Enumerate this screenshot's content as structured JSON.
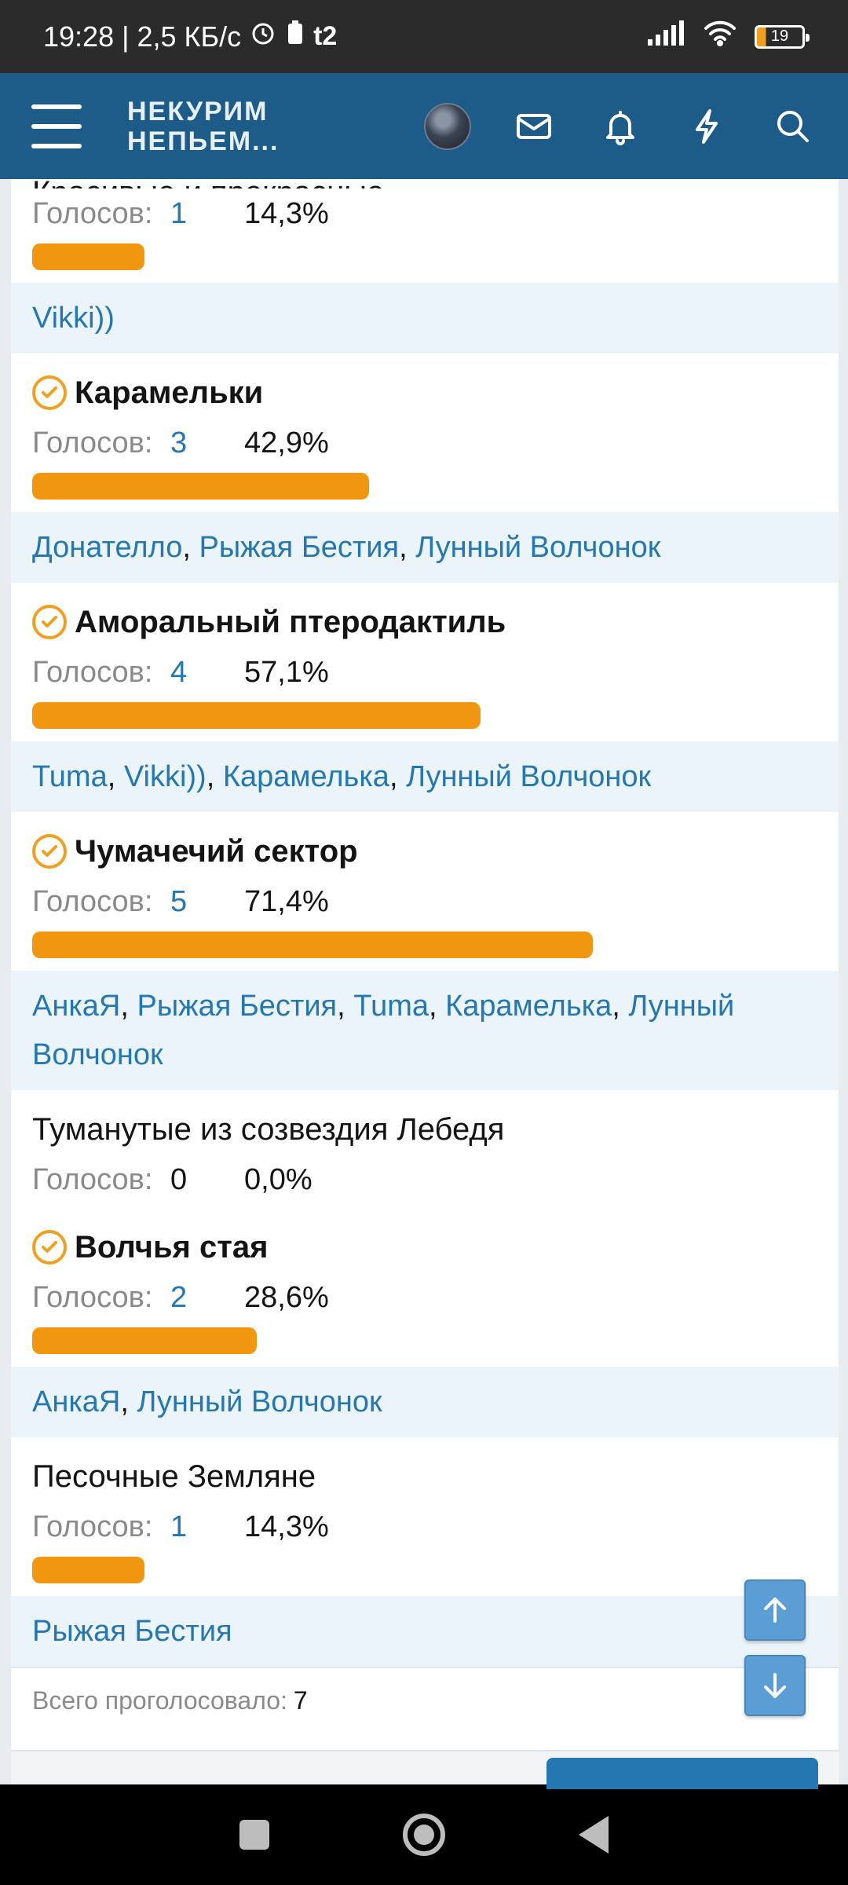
{
  "status": {
    "time_and_speed": "19:28 | 2,5 КБ/с",
    "carrier_icon": "t2-icon",
    "battery": "19"
  },
  "header": {
    "logo_line1": "НЕКУРИМ",
    "logo_line2": "НЕПЬЕМ..."
  },
  "poll": {
    "partial_title": "Красивые и прекрасные",
    "options": [
      {
        "votes_label": "Голосов:",
        "votes": "1",
        "percent": "14,3%",
        "fraction": 0.143
      },
      {
        "title": "Карамельки",
        "votes_label": "Голосов:",
        "votes": "3",
        "percent": "42,9%",
        "fraction": 0.429
      },
      {
        "title": "Аморальный птеродактиль",
        "votes_label": "Голосов:",
        "votes": "4",
        "percent": "57,1%",
        "fraction": 0.571
      },
      {
        "title": "Чумачечий сектор",
        "votes_label": "Голосов:",
        "votes": "5",
        "percent": "71,4%",
        "fraction": 0.714
      },
      {
        "title": "Туманутые из созвездия Лебедя",
        "votes_label": "Голосов:",
        "votes": "0",
        "percent": "0,0%",
        "fraction": 0
      },
      {
        "title": "Волчья стая",
        "votes_label": "Голосов:",
        "votes": "2",
        "percent": "28,6%",
        "fraction": 0.286
      },
      {
        "title": "Песочные Земляне",
        "votes_label": "Голосов:",
        "votes": "1",
        "percent": "14,3%",
        "fraction": 0.143
      }
    ],
    "voters": [
      [
        "Vikki))"
      ],
      [
        "Донателло",
        "Рыжая Бестия",
        "Лунный Волчонок"
      ],
      [
        "Tuma",
        "Vikki))",
        "Карамелька",
        "Лунный Волчонок"
      ],
      [
        "АнкаЯ",
        "Рыжая Бестия",
        "Tuma",
        "Карамелька",
        "Лунный Волчонок"
      ],
      [
        "АнкаЯ",
        "Лунный Волчонок"
      ],
      [
        "Рыжая Бестия"
      ]
    ],
    "separator": ",",
    "total_label": "Всего проголосовало:",
    "total": "7"
  },
  "colors": {
    "accent": "#1d5b88",
    "bar": "#f0960f",
    "link": "#2577b1",
    "voters_bg": "#ebf3fb"
  }
}
